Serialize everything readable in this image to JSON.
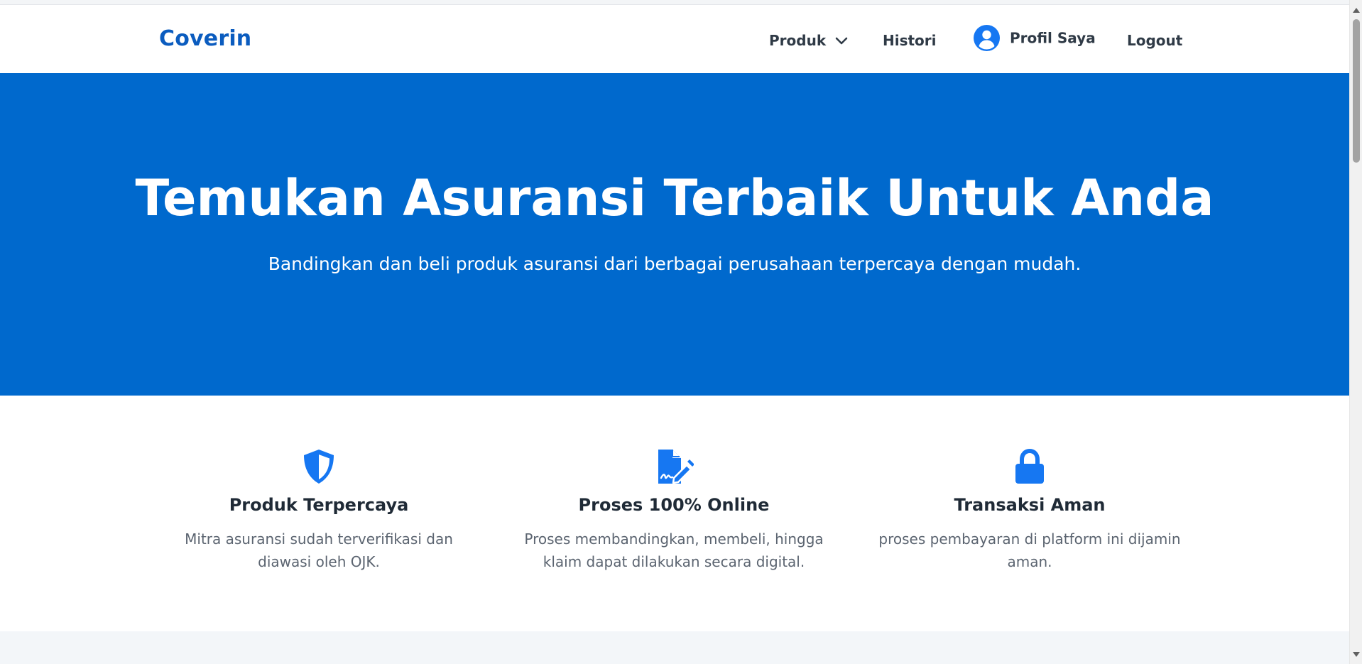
{
  "navbar": {
    "brand": "Coverin",
    "items": {
      "produk": "Produk",
      "histori": "Histori",
      "profil": "Profil Saya",
      "logout": "Logout"
    },
    "icons": {
      "produk": "chevron-down-icon",
      "profil": "user-circle-icon"
    }
  },
  "hero": {
    "title": "Temukan Asuransi Terbaik Untuk Anda",
    "subtitle": "Bandingkan dan beli produk asuransi dari berbagai perusahaan terpercaya dengan mudah."
  },
  "features": [
    {
      "icon": "shield-icon",
      "title": "Produk Terpercaya",
      "description": "Mitra asuransi sudah terverifikasi dan diawasi oleh OJK."
    },
    {
      "icon": "file-signature-icon",
      "title": "Proses 100% Online",
      "description": "Proses membandingkan, membeli, hingga klaim dapat dilakukan secara digital."
    },
    {
      "icon": "lock-icon",
      "title": "Transaksi Aman",
      "description": "proses pembayaran di platform ini dijamin aman."
    }
  ],
  "colors": {
    "brand": "#0b5cbf",
    "hero_background": "#0069cd",
    "icon_blue": "#1677f2"
  }
}
